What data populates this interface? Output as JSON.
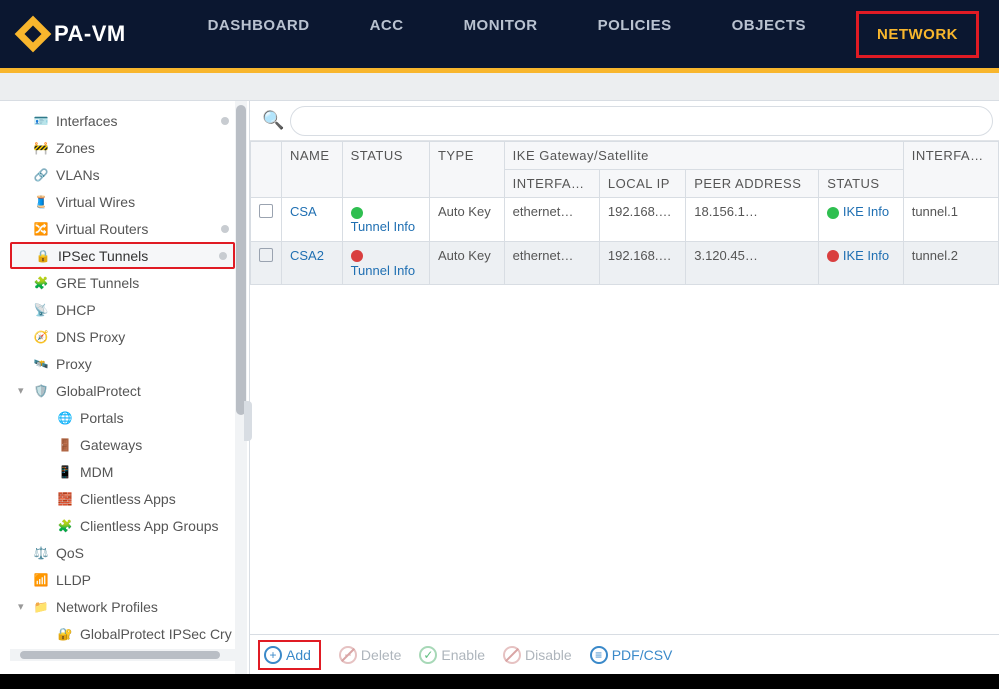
{
  "header": {
    "brand": "PA-VM",
    "nav": [
      {
        "label": "DASHBOARD"
      },
      {
        "label": "ACC"
      },
      {
        "label": "MONITOR"
      },
      {
        "label": "POLICIES"
      },
      {
        "label": "OBJECTS"
      },
      {
        "label": "NETWORK",
        "active": true
      }
    ]
  },
  "sidebar": {
    "items": [
      {
        "label": "Interfaces",
        "icon": "🪪",
        "dot": true
      },
      {
        "label": "Zones",
        "icon": "🚧"
      },
      {
        "label": "VLANs",
        "icon": "🔗"
      },
      {
        "label": "Virtual Wires",
        "icon": "🧵"
      },
      {
        "label": "Virtual Routers",
        "icon": "🔀",
        "dot": true
      },
      {
        "label": "IPSec Tunnels",
        "icon": "🔒",
        "dot": true,
        "selected": true
      },
      {
        "label": "GRE Tunnels",
        "icon": "🧩"
      },
      {
        "label": "DHCP",
        "icon": "📡"
      },
      {
        "label": "DNS Proxy",
        "icon": "🧭"
      },
      {
        "label": "Proxy",
        "icon": "🛰️"
      }
    ],
    "globalprotect": {
      "label": "GlobalProtect",
      "children": [
        {
          "label": "Portals",
          "icon": "🌐"
        },
        {
          "label": "Gateways",
          "icon": "🚪"
        },
        {
          "label": "MDM",
          "icon": "📱"
        },
        {
          "label": "Clientless Apps",
          "icon": "🧱"
        },
        {
          "label": "Clientless App Groups",
          "icon": "🧩"
        }
      ]
    },
    "post": [
      {
        "label": "QoS",
        "icon": "⚖️"
      },
      {
        "label": "LLDP",
        "icon": "📶"
      }
    ],
    "network_profiles": {
      "label": "Network Profiles",
      "children": [
        {
          "label": "GlobalProtect IPSec Cry",
          "icon": "🔐"
        }
      ]
    }
  },
  "search": {
    "placeholder": ""
  },
  "table": {
    "group_header": "IKE Gateway/Satellite",
    "columns": {
      "name": "NAME",
      "status": "STATUS",
      "type": "TYPE",
      "interface": "INTERFA…",
      "local_ip": "LOCAL IP",
      "peer": "PEER ADDRESS",
      "ike_status": "STATUS",
      "tunnel_iface": "INTERFA…"
    },
    "tunnel_info_label": "Tunnel Info",
    "ike_info_label": "IKE Info",
    "rows": [
      {
        "name": "CSA",
        "status": "green",
        "type": "Auto Key",
        "interface": "ethernet…",
        "local_ip": "192.168.…",
        "peer": "18.156.1…",
        "ike_status": "green",
        "tunnel_iface": "tunnel.1"
      },
      {
        "name": "CSA2",
        "status": "red",
        "type": "Auto Key",
        "interface": "ethernet…",
        "local_ip": "192.168.…",
        "peer": "3.120.45…",
        "ike_status": "red",
        "tunnel_iface": "tunnel.2"
      }
    ]
  },
  "actions": {
    "add": "Add",
    "delete": "Delete",
    "enable": "Enable",
    "disable": "Disable",
    "pdfcsv": "PDF/CSV"
  }
}
